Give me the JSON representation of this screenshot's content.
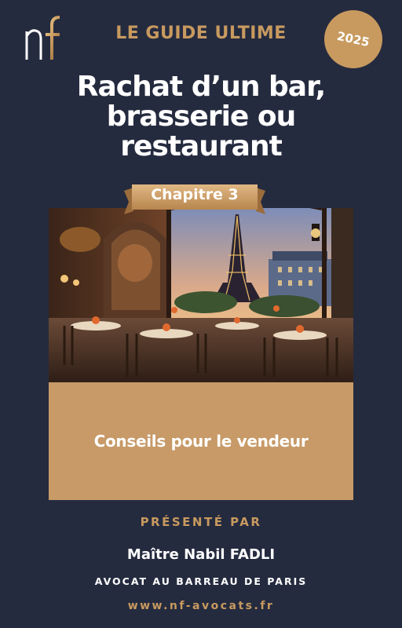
{
  "header": {
    "logo_text": "nf",
    "guide_label": "LE GUIDE ULTIME",
    "year": "2025"
  },
  "title": {
    "line1": "Rachat d’un bar,",
    "line2": "brasserie ou",
    "line3": "restaurant"
  },
  "chapter": "Chapitre 3",
  "hero_image": {
    "icon": "paris-cafe-terrace-eiffel-tower-illustration"
  },
  "subtitle": "Conseils pour le vendeur",
  "footer": {
    "presented_by": "PRÉSENTÉ PAR",
    "author": "Maître Nabil FADLI",
    "bar": "AVOCAT AU BARREAU DE PARIS",
    "website": "www.nf-avocats.fr"
  },
  "colors": {
    "background": "#252b3f",
    "gold": "#c89a5f",
    "tan": "#c79a68",
    "text": "#ffffff"
  }
}
